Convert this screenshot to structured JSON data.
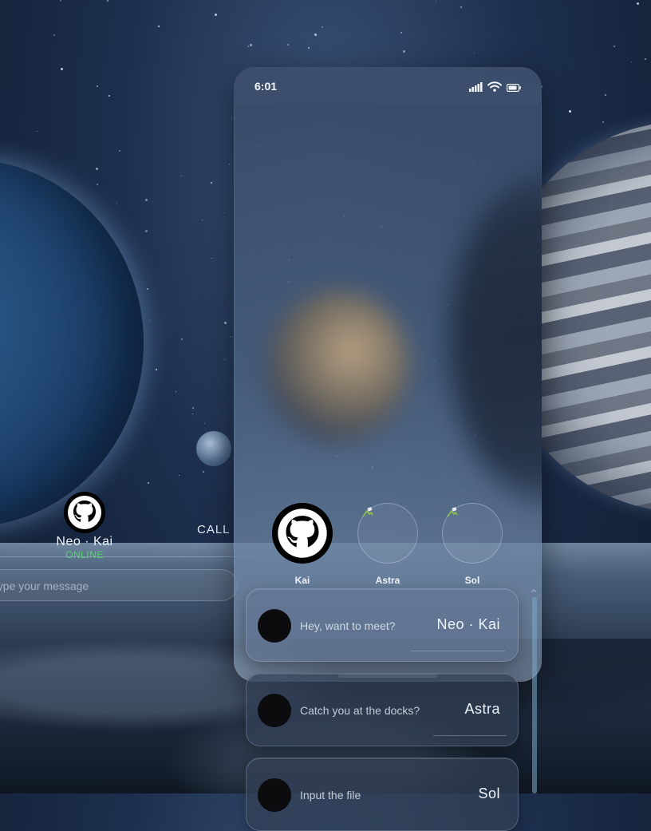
{
  "status_bar": {
    "time": "6:01"
  },
  "background_chat": {
    "contact_name": "Neo · Kai",
    "contact_status": "ONLINE",
    "call_label": "CALL",
    "message_placeholder": "Type your message"
  },
  "contacts": [
    {
      "name": "Kai",
      "avatar": "github-icon"
    },
    {
      "name": "Astra",
      "avatar": "broken-image-icon"
    },
    {
      "name": "Sol",
      "avatar": "broken-image-icon"
    }
  ],
  "chats": [
    {
      "message": "Hey, want to meet?",
      "name": "Neo · Kai"
    },
    {
      "message": "Catch you at the docks?",
      "name": "Astra"
    },
    {
      "message": "Input the file",
      "name": "Sol"
    }
  ],
  "colors": {
    "online": "#4cd964",
    "accent": "#9fd0e0"
  }
}
